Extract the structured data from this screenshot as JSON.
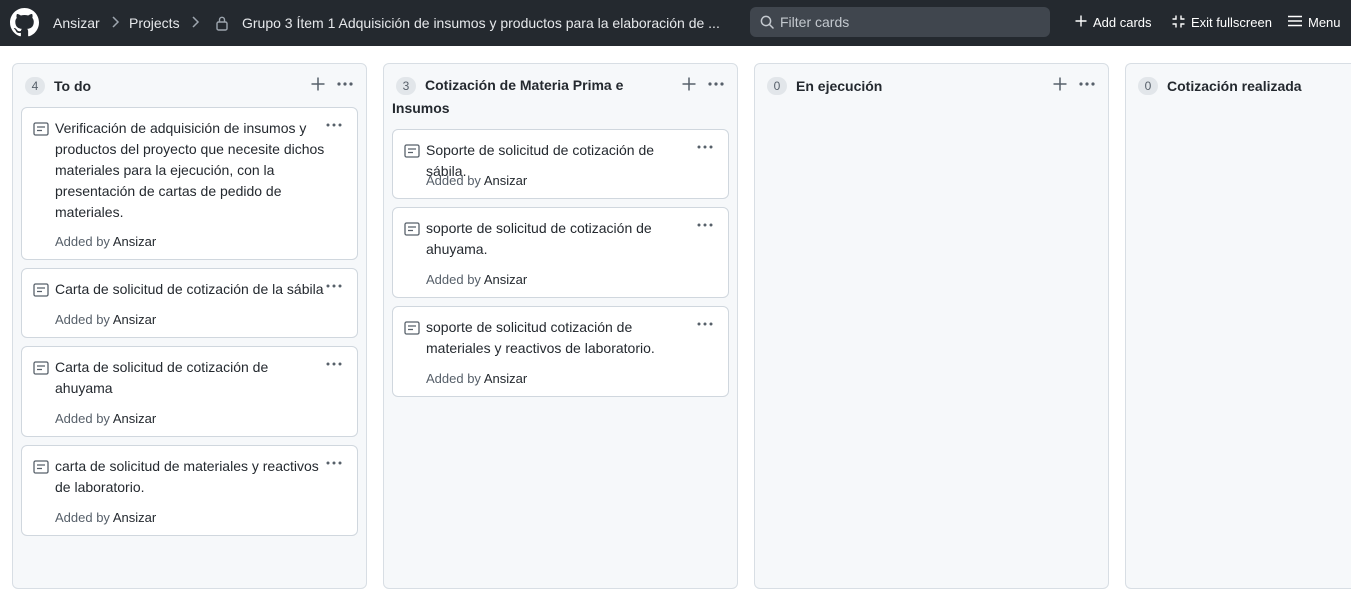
{
  "header": {
    "breadcrumb": [
      "Ansizar",
      "Projects"
    ],
    "project_title": "Grupo 3 Ítem 1 Adquisición de insumos y productos para la elaboración de ...",
    "search": {
      "placeholder": "Filter cards",
      "value": ""
    },
    "actions": {
      "add_cards": "Add cards",
      "exit_fullscreen": "Exit fullscreen",
      "menu": "Menu"
    },
    "icons": [
      "github-logo",
      "chevron-right-icon",
      "lock-icon",
      "search-icon",
      "plus-icon",
      "minimize-icon",
      "hamburger-icon"
    ]
  },
  "columns": [
    {
      "count": "4",
      "title": "To do",
      "cards": [
        {
          "text": "Verificación de adquisición de insumos y productos del proyecto que necesite dichos materiales para la ejecución, con la presentación de cartas de pedido de materiales.",
          "meta_prefix": "Added by",
          "author": "Ansizar"
        },
        {
          "text": "Carta de solicitud de cotización de la sábila",
          "meta_prefix": "Added by",
          "author": "Ansizar"
        },
        {
          "text": "Carta de solicitud de cotización de ahuyama",
          "meta_prefix": "Added by",
          "author": "Ansizar"
        },
        {
          "text": "carta de solicitud de materiales y reactivos de laboratorio.",
          "meta_prefix": "Added by",
          "author": "Ansizar"
        }
      ]
    },
    {
      "count": "3",
      "title": "Cotización de Materia Prima e Insumos",
      "cards": [
        {
          "text": "Soporte de solicitud de cotización de sábila.",
          "meta_prefix": "Added by",
          "author": "Ansizar"
        },
        {
          "text": "soporte de solicitud de cotización de ahuyama.",
          "meta_prefix": "Added by",
          "author": "Ansizar"
        },
        {
          "text": "soporte de solicitud cotización de materiales y reactivos de laboratorio.",
          "meta_prefix": "Added by",
          "author": "Ansizar"
        }
      ]
    },
    {
      "count": "0",
      "title": "En ejecución",
      "cards": []
    },
    {
      "count": "0",
      "title": "Cotización realizada",
      "cards": []
    }
  ],
  "colors": {
    "header_bg": "#24292f",
    "column_bg": "#f6f8fa",
    "card_border": "#d0d7de",
    "muted_text": "#57606a"
  }
}
